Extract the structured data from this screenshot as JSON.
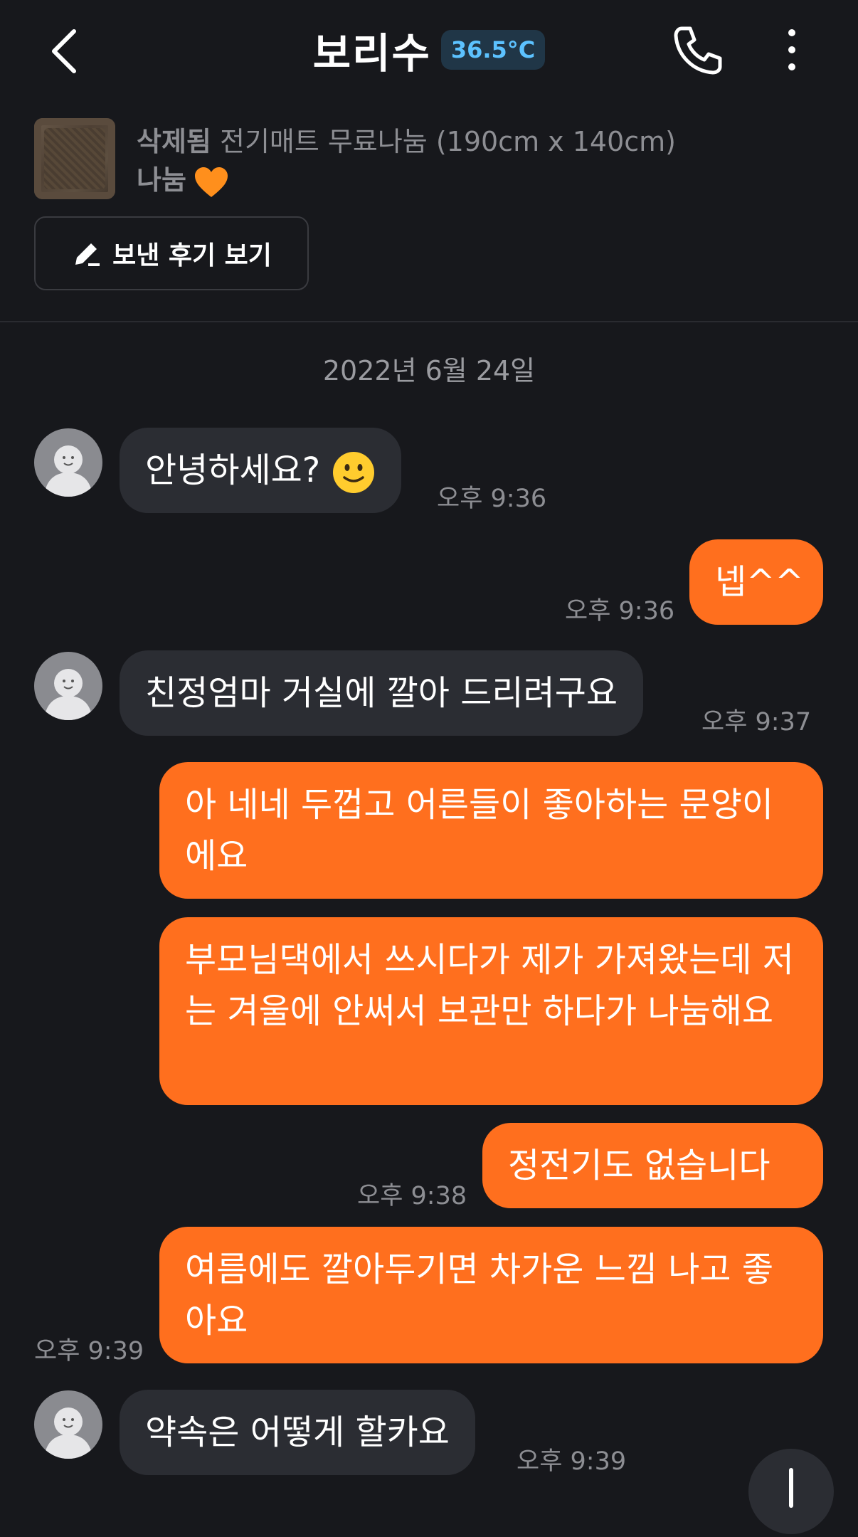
{
  "header": {
    "name": "보리수",
    "temperature": "36.5°C"
  },
  "product": {
    "status": "삭제됨",
    "title": "전기매트 무료나눔 (190cm x 140cm)",
    "price": "나눔"
  },
  "review_button": {
    "label": "보낸 후기 보기"
  },
  "date_separator": "2022년 6월 24일",
  "messages": [
    {
      "text": "안녕하세요?",
      "time": "오후 9:36"
    },
    {
      "text": "넵^^",
      "time": "오후 9:36"
    },
    {
      "text": "친정엄마 거실에 깔아 드리려구요",
      "time": "오후 9:37"
    },
    {
      "text": "아 네네 두껍고 어른들이 좋아하는 문양이에요"
    },
    {
      "text": "부모님댁에서 쓰시다가 제가 가져왔는데 저는 겨울에 안써서 보관만 하다가 나눔해요"
    },
    {
      "text": "정전기도 없습니다",
      "time": "오후 9:38"
    },
    {
      "text": "여름에도 깔아두기면 차가운 느낌 나고 좋아요",
      "time": "오후 9:39"
    },
    {
      "text": "약속은 어떻게 할카요",
      "time": "오후 9:39"
    }
  ],
  "colors": {
    "accent": "#ff6f1e",
    "background": "#17181c",
    "incoming_bubble": "#2b2d33"
  }
}
